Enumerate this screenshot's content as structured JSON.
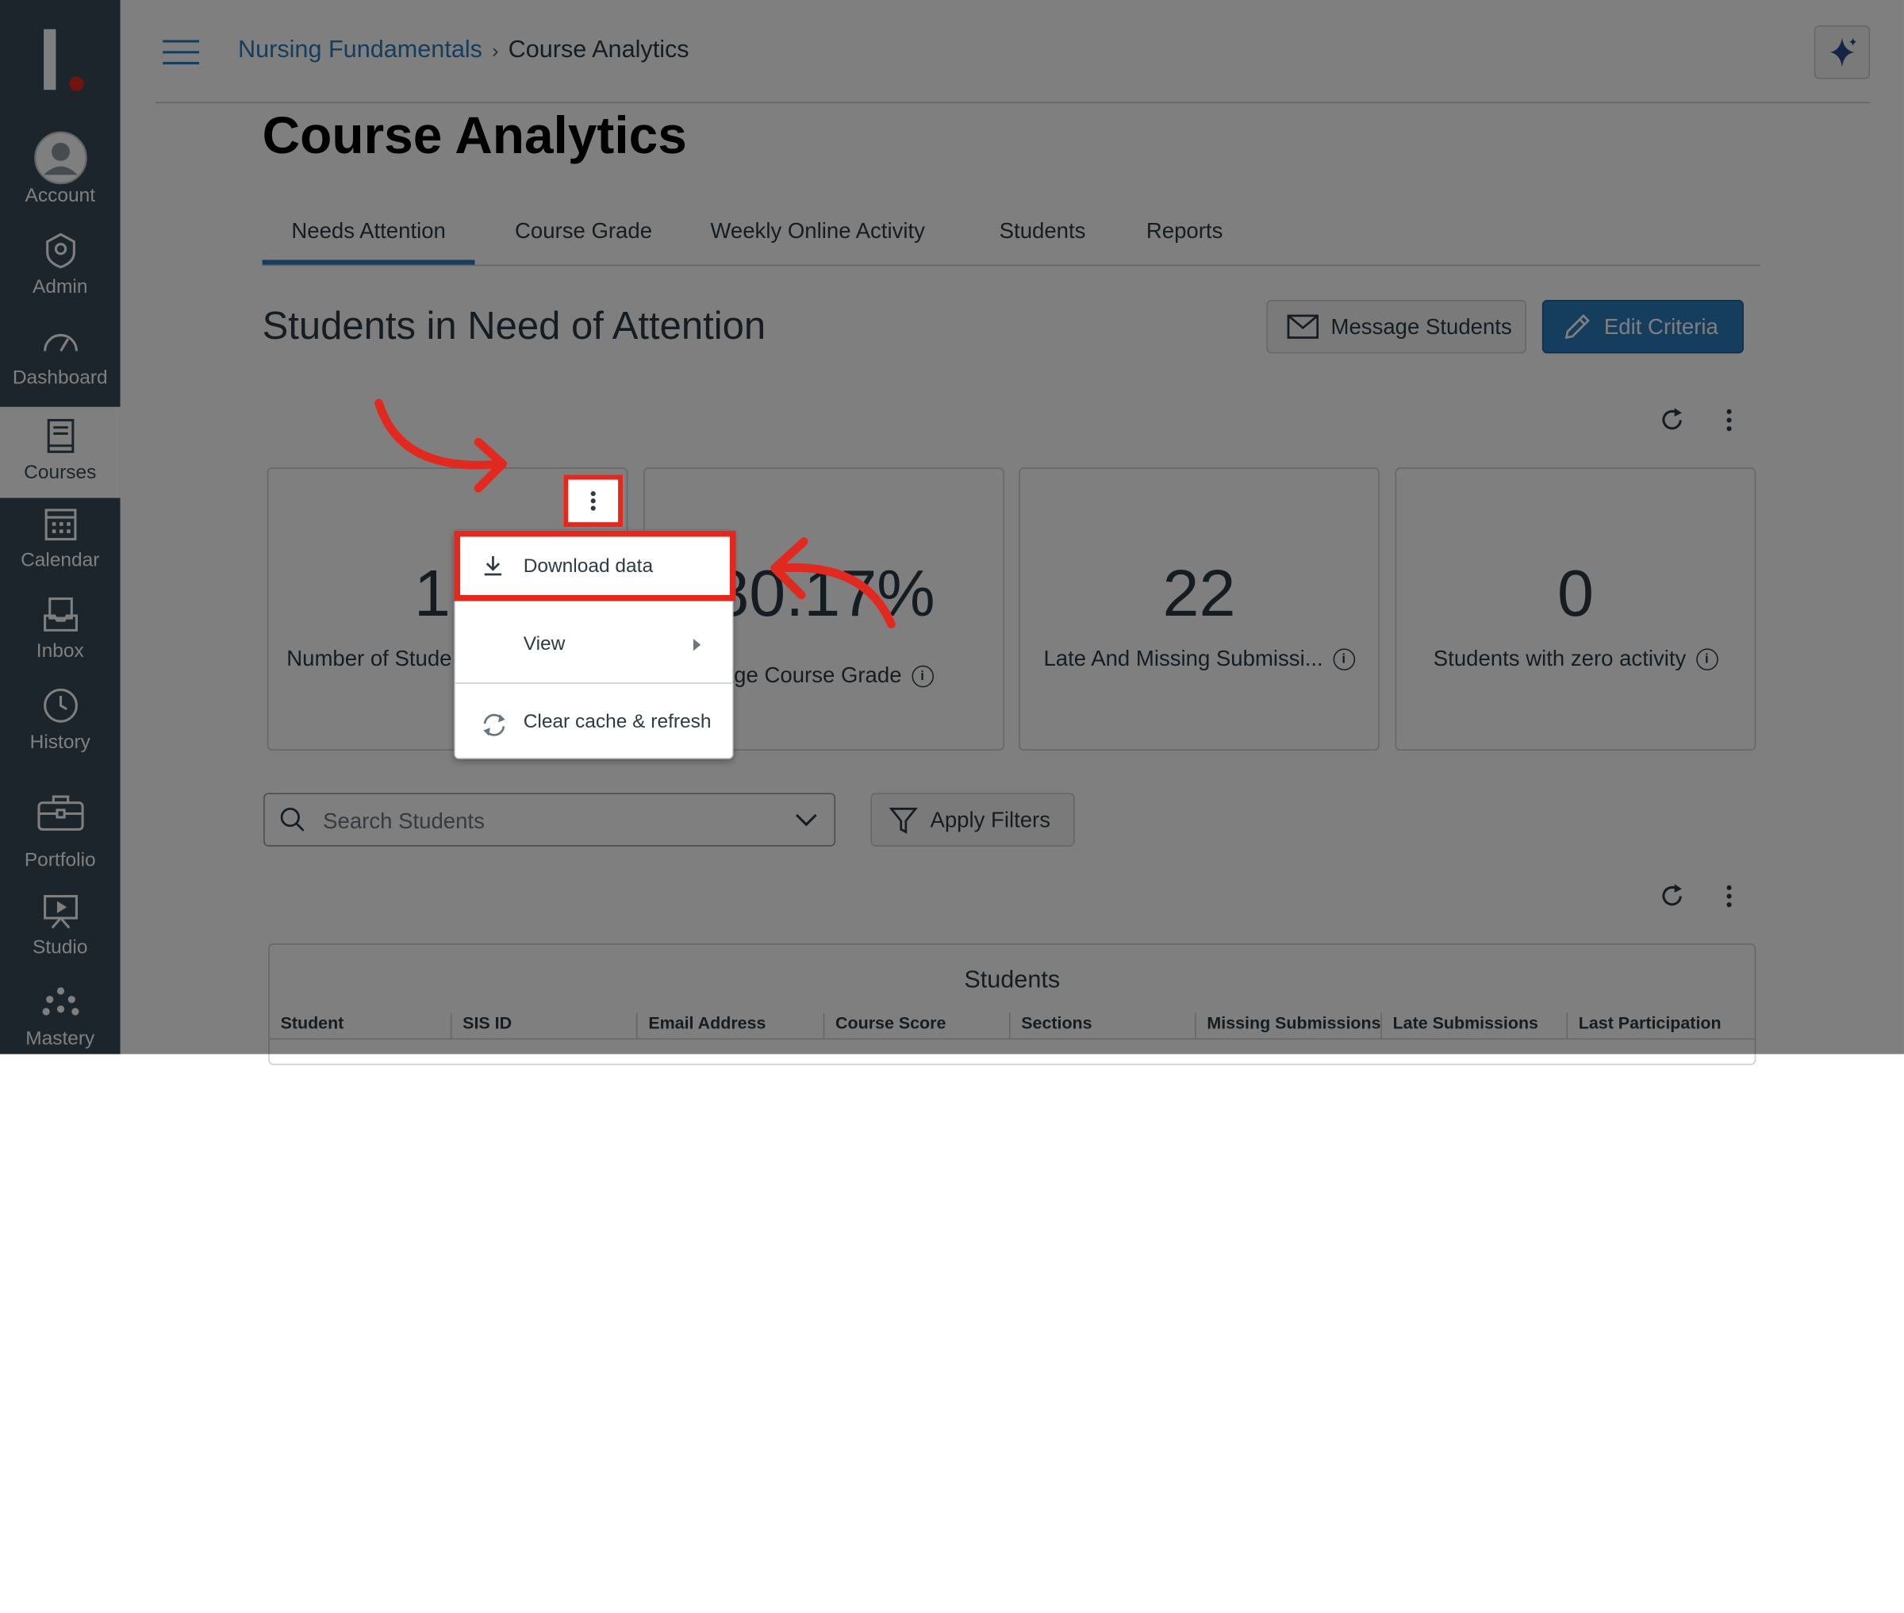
{
  "nav": {
    "items": [
      {
        "label": "Account",
        "icon": "account-icon"
      },
      {
        "label": "Admin",
        "icon": "admin-icon"
      },
      {
        "label": "Dashboard",
        "icon": "dashboard-icon"
      },
      {
        "label": "Courses",
        "icon": "courses-icon"
      },
      {
        "label": "Calendar",
        "icon": "calendar-icon"
      },
      {
        "label": "Inbox",
        "icon": "inbox-icon"
      },
      {
        "label": "History",
        "icon": "history-icon"
      },
      {
        "label": "Portfolio",
        "icon": "portfolio-icon"
      },
      {
        "label": "Studio",
        "icon": "studio-icon"
      },
      {
        "label": "Mastery",
        "icon": "mastery-icon"
      }
    ],
    "active": "Courses"
  },
  "header": {
    "breadcrumb": [
      "Nursing Fundamentals",
      "Course Analytics"
    ],
    "sep": "›"
  },
  "page": {
    "title": "Course Analytics",
    "tabs": [
      "Needs Attention",
      "Course Grade",
      "Weekly Online Activity",
      "Students",
      "Reports"
    ],
    "selected_tab": "Needs Attention",
    "section_title": "Students in Need of Attention",
    "message_button": "Message Students",
    "edit_button": "Edit Criteria"
  },
  "cards": [
    {
      "value": "1",
      "caption": "Number of Stude"
    },
    {
      "value": "80.17%",
      "caption": "rage Course Grade"
    },
    {
      "value": "22",
      "caption": "Late And Missing Submissi..."
    },
    {
      "value": "0",
      "caption": "Students with zero activity"
    }
  ],
  "menu": {
    "items": [
      "Download data",
      "View",
      "Clear cache & refresh"
    ]
  },
  "filters": {
    "search_placeholder": "Search Students",
    "apply_label": "Apply Filters"
  },
  "table": {
    "caption": "Students",
    "columns": [
      "Student",
      "SIS ID",
      "Email Address",
      "Course Score",
      "Sections",
      "Missing Submissions",
      "Late Submissions",
      "Last Participation"
    ]
  },
  "colors": {
    "accent": "#2b7abc",
    "nav_bg": "#394b58",
    "highlight": "#e1291f",
    "logo_dot": "#e1291f"
  }
}
